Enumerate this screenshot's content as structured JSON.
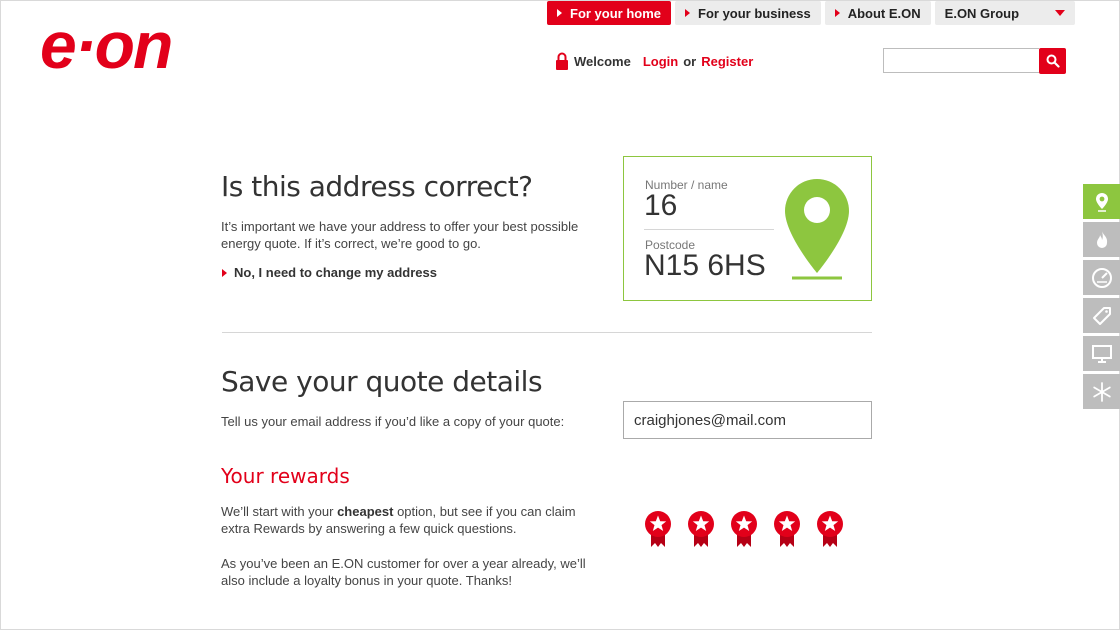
{
  "brand": {
    "logo_text": "e·on",
    "accent": "#e2001a",
    "green": "#8dc63f"
  },
  "topnav": {
    "tabs": [
      {
        "label": "For your home",
        "active": true
      },
      {
        "label": "For your business",
        "active": false
      },
      {
        "label": "About E.ON",
        "active": false
      }
    ],
    "group_dropdown": "E.ON Group"
  },
  "account": {
    "welcome": "Welcome",
    "login": "Login",
    "or": "or",
    "register": "Register"
  },
  "search": {
    "placeholder": "",
    "icon": "search-icon"
  },
  "sidetools": {
    "items": [
      {
        "icon": "location-pin-icon",
        "active": true
      },
      {
        "icon": "flame-icon",
        "active": false
      },
      {
        "icon": "gauge-icon",
        "active": false
      },
      {
        "icon": "tag-icon",
        "active": false
      },
      {
        "icon": "monitor-icon",
        "active": false
      },
      {
        "icon": "snowflake-icon",
        "active": false
      }
    ]
  },
  "address": {
    "title": "Is this address correct?",
    "description": "It’s important we have your address to offer your best possible energy quote. If it’s correct, we’re good to go.",
    "change_link": "No, I need to change my address",
    "number_label": "Number / name",
    "number_value": "16",
    "postcode_label": "Postcode",
    "postcode_value": "N15 6HS"
  },
  "save_quote": {
    "title": "Save your quote details",
    "description": "Tell us your email address if you’d like a copy of your quote:",
    "email_value": "craighjones@mail.com"
  },
  "rewards": {
    "title": "Your rewards",
    "p1_before": "We’ll start with your ",
    "p1_bold": "cheapest",
    "p1_after": " option, but see if you can claim extra Rewards by answering a few quick questions.",
    "p2": "As you’ve been an E.ON customer for over a year already, we’ll also include a loyalty bonus in your quote. Thanks!",
    "star_count": 5
  }
}
